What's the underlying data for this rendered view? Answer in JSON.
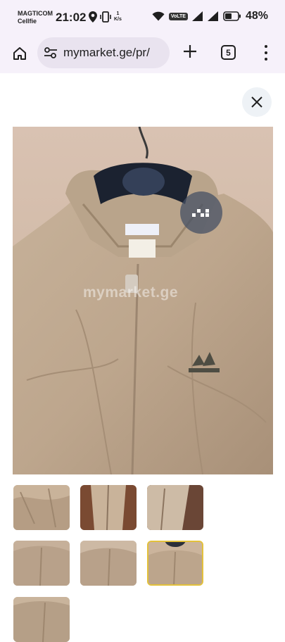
{
  "status_bar": {
    "carrier_line1": "MAGTICOM",
    "carrier_line2": "Cellfie",
    "time": "21:02",
    "net_speed_value": "1",
    "net_speed_unit": "K/s",
    "volte_label": "VoLTE",
    "battery_percent": "48%"
  },
  "browser": {
    "url": "mymarket.ge/pr/",
    "tab_count": "5"
  },
  "image": {
    "watermark": "mymarket.ge"
  },
  "thumbnails": [
    {
      "selected": false
    },
    {
      "selected": false
    },
    {
      "selected": false
    },
    {
      "selected": false
    },
    {
      "selected": false
    },
    {
      "selected": true
    },
    {
      "selected": false
    }
  ]
}
